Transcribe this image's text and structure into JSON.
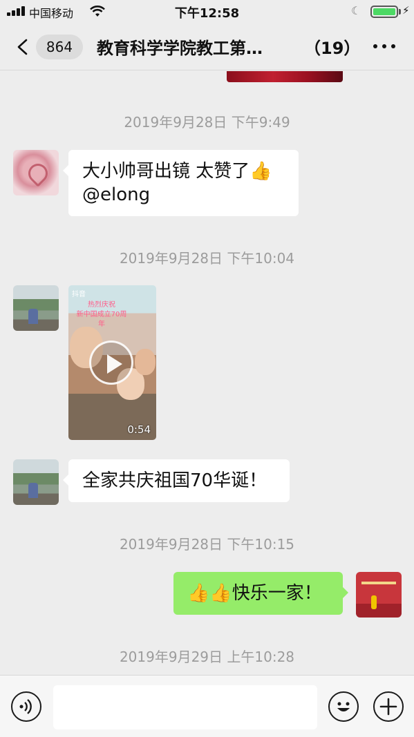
{
  "status_bar": {
    "carrier": "中国移动",
    "time": "下午12:58"
  },
  "header": {
    "back_count": "864",
    "title": "教育科学学院教工第…",
    "member_count": "（19）"
  },
  "messages": [
    {
      "type": "timestamp",
      "text": "2019年9月28日 下午9:49"
    },
    {
      "type": "text",
      "side": "left",
      "avatar": "hands-avatar",
      "line1": "大小帅哥出镜 太赞了👍",
      "line2": "@elong"
    },
    {
      "type": "timestamp",
      "text": "2019年9月28日 下午10:04"
    },
    {
      "type": "video",
      "side": "left",
      "avatar": "garden-avatar",
      "brand": "抖音",
      "caption_line1": "热烈庆祝",
      "caption_line2": "新中国成立70周年",
      "duration": "0:54"
    },
    {
      "type": "text",
      "side": "left",
      "avatar": "garden-avatar",
      "text": "全家共庆祖国70华诞！"
    },
    {
      "type": "timestamp",
      "text": "2019年9月28日 下午10:15"
    },
    {
      "type": "text",
      "side": "right",
      "avatar": "me-avatar",
      "text": "👍👍快乐一家！"
    },
    {
      "type": "timestamp",
      "text": "2019年9月29日 上午10:28"
    }
  ],
  "input": {
    "placeholder": ""
  },
  "icons": {
    "voice": "voice-icon",
    "emoji": "emoji-icon",
    "plus": "plus-icon",
    "more": "more-icon",
    "back": "chevron-left-icon"
  },
  "colors": {
    "background": "#ededed",
    "my_bubble": "#95ec69",
    "other_bubble": "#ffffff",
    "timestamp": "#9c9c9c"
  }
}
